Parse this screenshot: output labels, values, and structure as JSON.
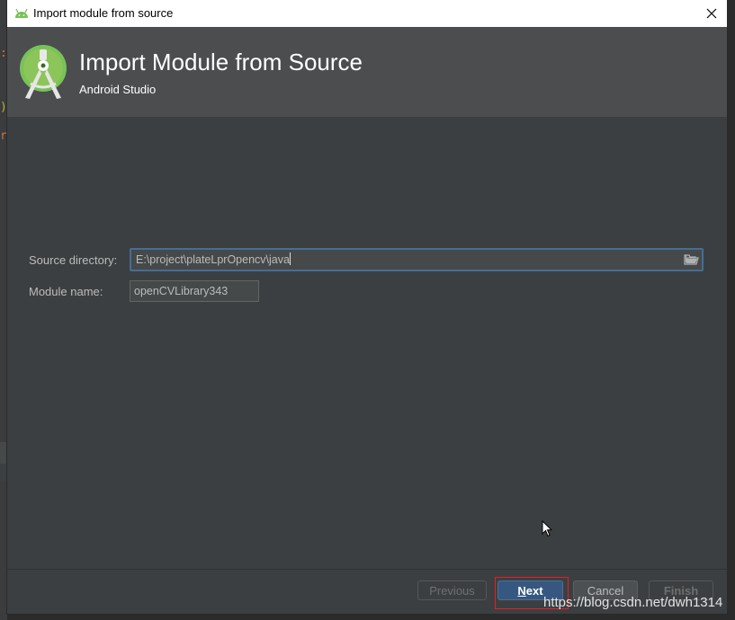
{
  "window": {
    "title": "Import module from source",
    "close_icon": "close-icon",
    "app_icon": "android-icon"
  },
  "header": {
    "title": "Import Module from Source",
    "subtitle": "Android Studio",
    "logo_icon": "android-studio-logo-icon"
  },
  "form": {
    "source_directory": {
      "label": "Source directory:",
      "value": "E:\\project\\plateLprOpencv\\java",
      "browse_icon": "folder-icon"
    },
    "module_name": {
      "label": "Module name:",
      "value": "openCVLibrary343"
    }
  },
  "buttons": {
    "previous": "Previous",
    "next_mnemonic": "N",
    "next_rest": "ext",
    "cancel": "Cancel",
    "finish": "Finish"
  },
  "watermark": "https://blog.csdn.net/dwh1314",
  "colors": {
    "dialog_bg": "#3c3f41",
    "header_bg": "#4b4d4f",
    "next_button": "#365880",
    "focus_border": "#466d94",
    "highlight_box": "#e0202a",
    "android_green": "#78c257"
  }
}
